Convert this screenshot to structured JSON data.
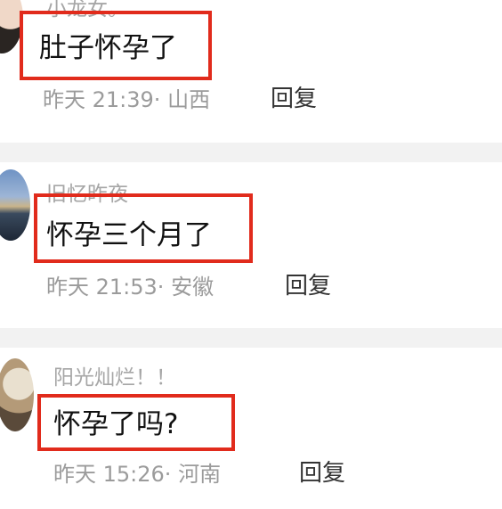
{
  "comments": [
    {
      "username": "小龙女。",
      "content": "肚子怀孕了",
      "time": "昨天 21:39",
      "sep": "·",
      "location": "山西",
      "reply_label": "回复"
    },
    {
      "username": "旧忆昨夜",
      "content": "怀孕三个月了",
      "time": "昨天 21:53",
      "sep": "·",
      "location": "安徽",
      "reply_label": "回复"
    },
    {
      "username": "阳光灿烂！！",
      "content": "怀孕了吗?",
      "time": "昨天 15:26",
      "sep": "·",
      "location": "河南",
      "reply_label": "回复"
    }
  ],
  "colors": {
    "highlight": "#e12b1c",
    "background": "#f2f2f2",
    "meta": "#9b9b9b",
    "username": "#a6a6a6"
  }
}
